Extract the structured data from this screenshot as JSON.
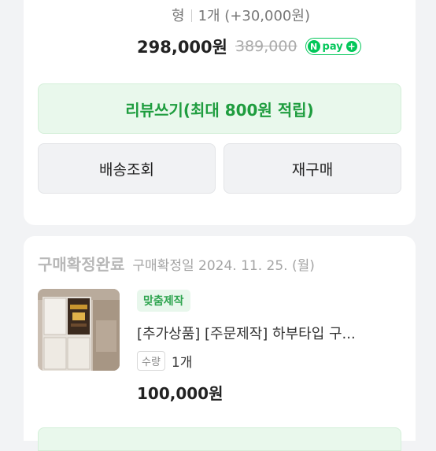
{
  "order_top": {
    "option_text": "형",
    "option_qty": "1개 (+30,000원)",
    "price": "298,000원",
    "original_price": "389,000",
    "npay_label": "pay"
  },
  "actions": {
    "review_button": "리뷰쓰기(최대 800원 적립)",
    "delivery_button": "배송조회",
    "reorder_button": "재구매"
  },
  "order_item": {
    "status": "구매확정완료",
    "status_date": "구매확정일 2024. 11. 25. (월)",
    "tag": "맞춤제작",
    "product_name": "[추가상품] [주문제작] 하부타입 구...",
    "qty_label": "수량",
    "qty_value": "1개",
    "price": "100,000원"
  },
  "colors": {
    "accent_green": "#03c75a",
    "review_bg": "#e9f8ec",
    "review_text": "#1f9d3f"
  }
}
